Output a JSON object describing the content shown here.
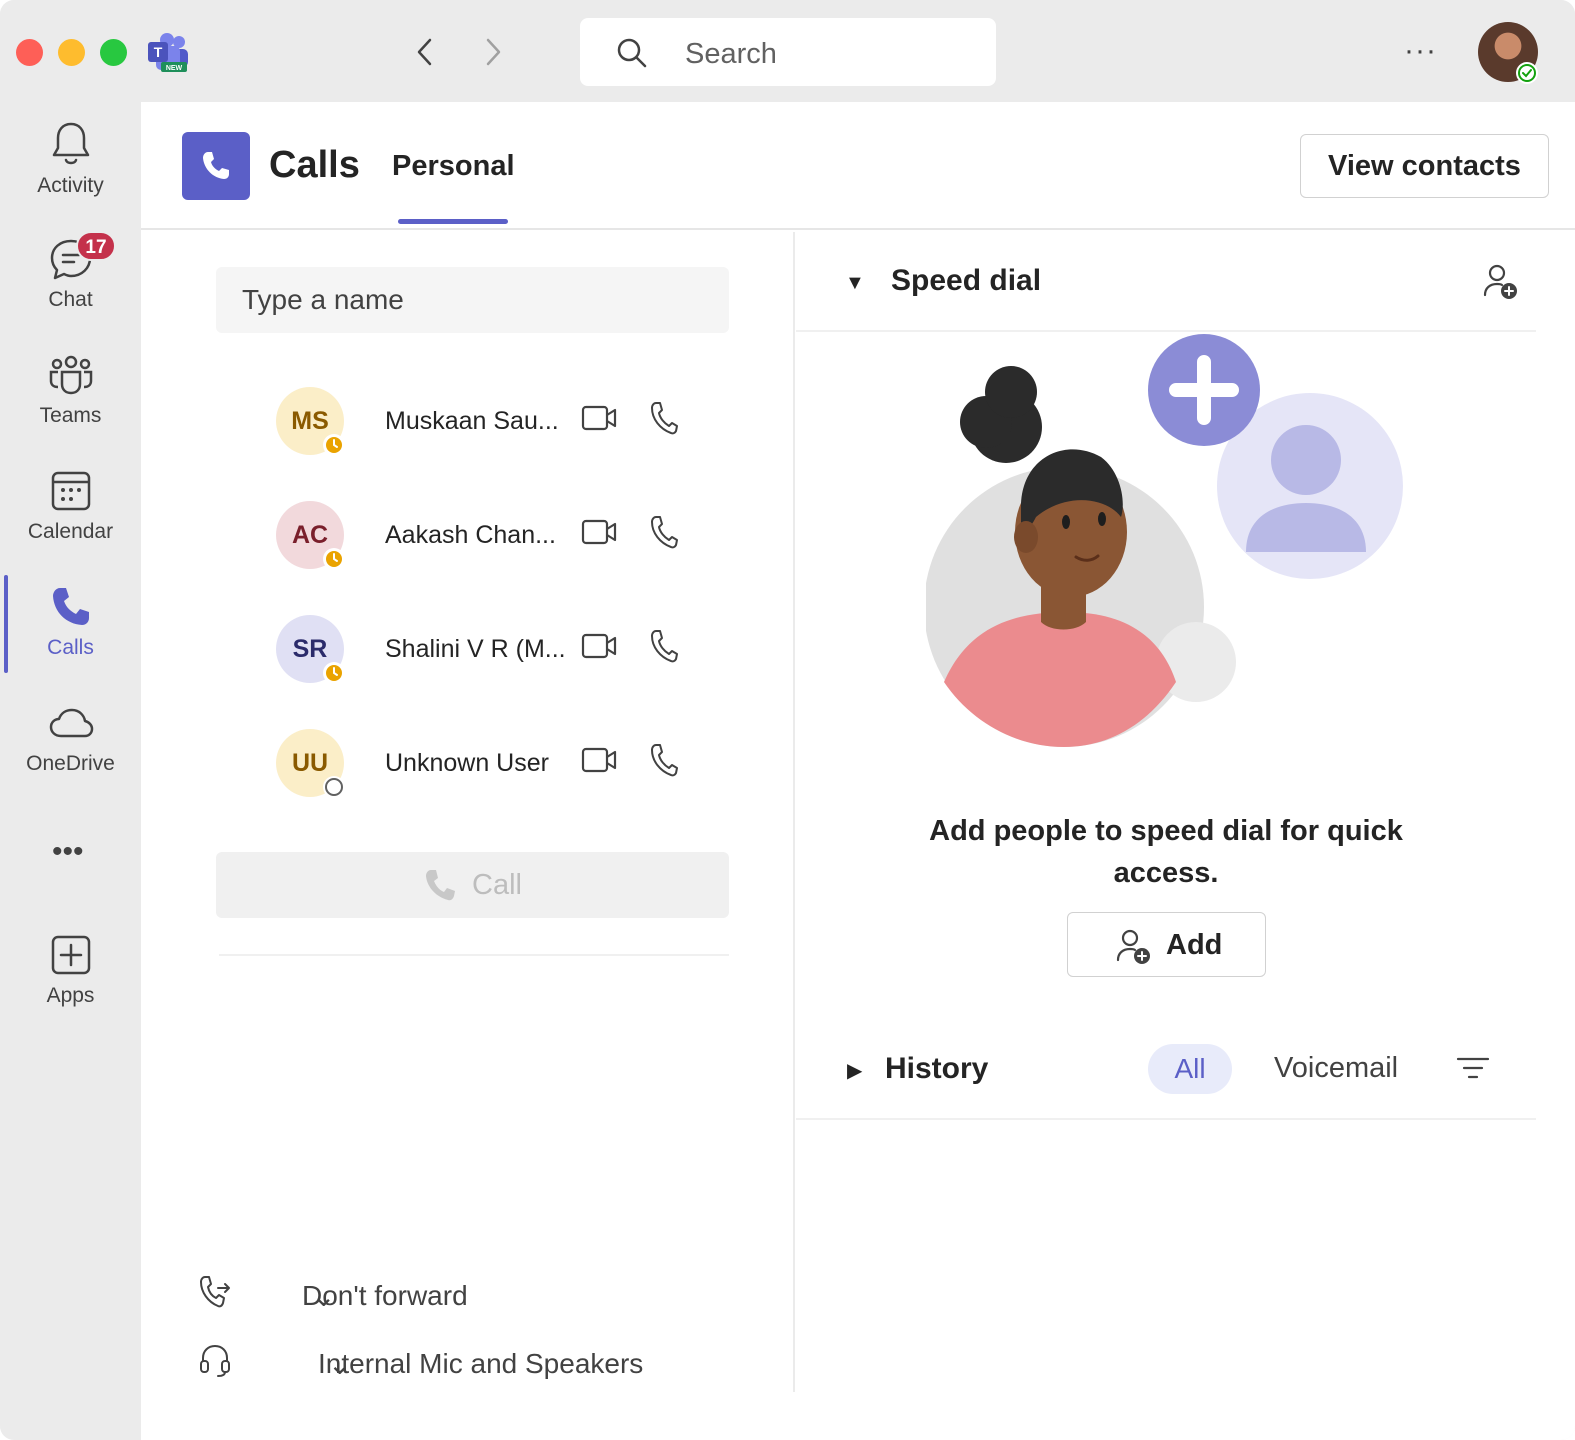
{
  "titlebar": {
    "search_placeholder": "Search",
    "more_label": "···"
  },
  "rail": {
    "items": [
      {
        "label": "Activity"
      },
      {
        "label": "Chat",
        "badge": "17"
      },
      {
        "label": "Teams"
      },
      {
        "label": "Calendar"
      },
      {
        "label": "Calls",
        "active": true
      },
      {
        "label": "OneDrive"
      },
      {
        "label": "Apps"
      }
    ],
    "more_label": "•••"
  },
  "header": {
    "title": "Calls",
    "tab": "Personal",
    "view_contacts": "View contacts"
  },
  "dialer": {
    "input_placeholder": "Type a name",
    "contacts": [
      {
        "initials": "MS",
        "name": "Muskaan Sau...",
        "avatar_bg": "#fbeec8",
        "avatar_fg": "#8a5a00",
        "status": "away"
      },
      {
        "initials": "AC",
        "name": "Aakash Chan...",
        "avatar_bg": "#f2d9dc",
        "avatar_fg": "#7a1f2b",
        "status": "away"
      },
      {
        "initials": "SR",
        "name": "Shalini V R (M...",
        "avatar_bg": "#e0e0f4",
        "avatar_fg": "#2b2b6b",
        "status": "away"
      },
      {
        "initials": "UU",
        "name": "Unknown User",
        "avatar_bg": "#fbeec8",
        "avatar_fg": "#8a5a00",
        "status": "offline"
      }
    ],
    "call_label": "Call",
    "forward_label": "Don't forward",
    "device_label": "Internal Mic and Speakers"
  },
  "speed_dial": {
    "title": "Speed dial",
    "empty_text": "Add people to speed dial for quick access.",
    "add_label": "Add"
  },
  "history": {
    "title": "History",
    "filters": [
      "All",
      "Voicemail"
    ],
    "active_filter": "All"
  },
  "colors": {
    "accent": "#5b5fc7",
    "badge": "#c4314b",
    "away": "#eaa300"
  }
}
